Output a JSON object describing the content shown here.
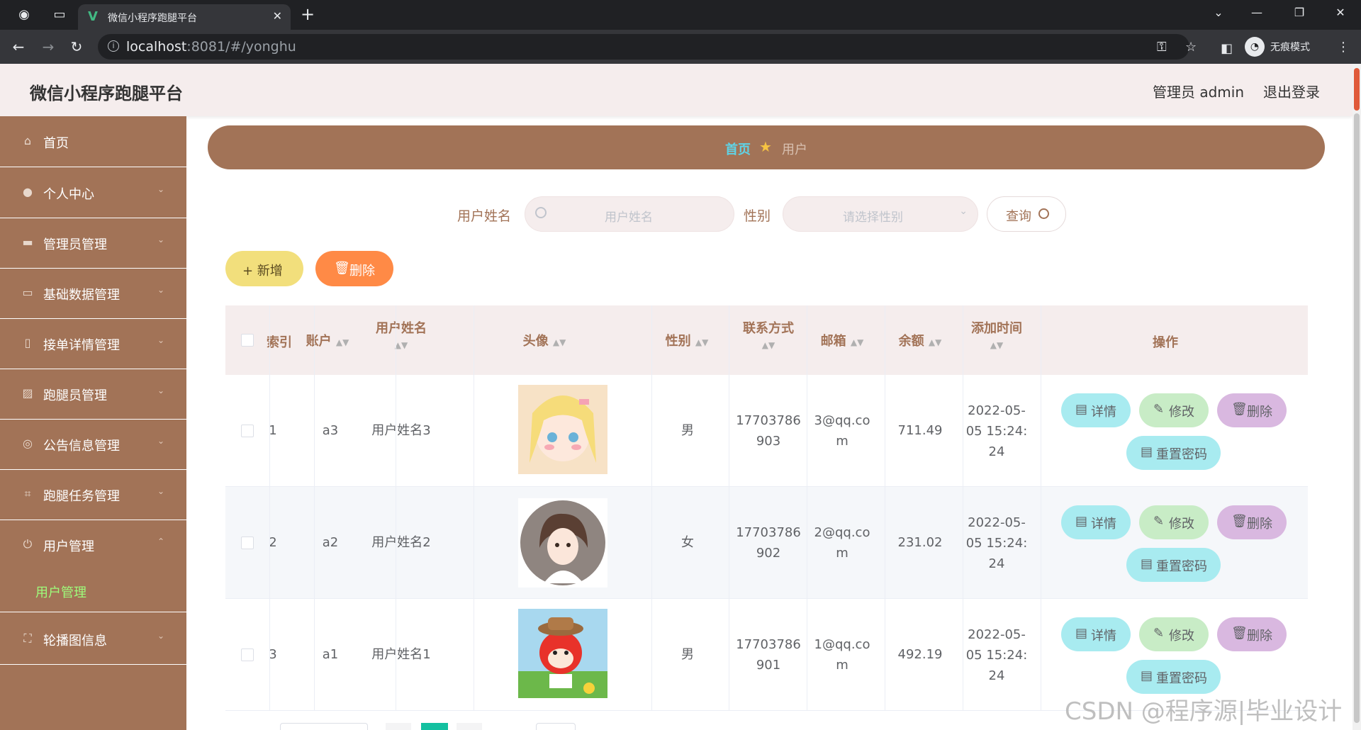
{
  "browser": {
    "tab_title": "微信小程序跑腿平台",
    "url_host": "localhost",
    "url_rest": ":8081/#/yonghu",
    "incognito_label": "无痕模式",
    "icons": [
      "globe-icon",
      "window-icon",
      "vue-favicon-icon",
      "close-icon",
      "plus-icon",
      "back-icon",
      "forward-icon",
      "reload-icon",
      "info-icon",
      "key-icon",
      "star-icon",
      "sidepanel-icon",
      "incognito-icon",
      "menu-dots-icon"
    ]
  },
  "header": {
    "app_title": "微信小程序跑腿平台",
    "admin_label": "管理员 admin",
    "logout_label": "退出登录"
  },
  "sidebar": {
    "items": [
      {
        "label": "首页",
        "icon": "home-icon"
      },
      {
        "label": "个人中心",
        "icon": "user-icon"
      },
      {
        "label": "管理员管理",
        "icon": "chat-icon"
      },
      {
        "label": "基础数据管理",
        "icon": "message-icon"
      },
      {
        "label": "接单详情管理",
        "icon": "phone-icon"
      },
      {
        "label": "跑腿员管理",
        "icon": "picture-icon"
      },
      {
        "label": "公告信息管理",
        "icon": "target-icon"
      },
      {
        "label": "跑腿任务管理",
        "icon": "crop-icon"
      },
      {
        "label": "用户管理",
        "icon": "power-icon"
      },
      {
        "label": "轮播图信息",
        "icon": "fullscreen-icon"
      }
    ],
    "submenu_label": "用户管理"
  },
  "breadcrumb": {
    "home": "首页",
    "current": "用户"
  },
  "search": {
    "name_label": "用户姓名",
    "name_placeholder": "用户姓名",
    "gender_label": "性别",
    "gender_placeholder": "请选择性别",
    "query_label": "查询"
  },
  "actions": {
    "add_label": "+ 新增",
    "delete_label": "删除"
  },
  "table": {
    "headers": {
      "index": "索引",
      "account": "账户",
      "name": "用户姓名",
      "avatar": "头像",
      "gender": "性别",
      "contact": "联系方式",
      "email": "邮箱",
      "balance": "余额",
      "added_time": "添加时间",
      "operation": "操作"
    },
    "rows": [
      {
        "index": "1",
        "account": "a3",
        "name": "用户姓名3",
        "gender": "男",
        "contact_1": "17703786",
        "contact_2": "903",
        "email_1": "3@qq.co",
        "email_2": "m",
        "balance": "711.49",
        "time_1": "2022-05-",
        "time_2": "05 15:24:",
        "time_3": "24"
      },
      {
        "index": "2",
        "account": "a2",
        "name": "用户姓名2",
        "gender": "女",
        "contact_1": "17703786",
        "contact_2": "902",
        "email_1": "2@qq.co",
        "email_2": "m",
        "balance": "231.02",
        "time_1": "2022-05-",
        "time_2": "05 15:24:",
        "time_3": "24"
      },
      {
        "index": "3",
        "account": "a1",
        "name": "用户姓名1",
        "gender": "男",
        "contact_1": "17703786",
        "contact_2": "901",
        "email_1": "1@qq.co",
        "email_2": "m",
        "balance": "492.19",
        "time_1": "2022-05-",
        "time_2": "05 15:24:",
        "time_3": "24"
      }
    ],
    "op_labels": {
      "detail": "详情",
      "edit": "修改",
      "delete": "删除",
      "reset": "重置密码"
    }
  },
  "watermark": "CSDN @程序源|毕业设计",
  "colors": {
    "brand_brown": "#a27357",
    "header_bg": "#f5eded",
    "active_submenu": "#9efc7b",
    "breadcrumb_home": "#5fd3e6",
    "add_btn": "#f2df7c",
    "delete_btn": "#ff8a46"
  }
}
